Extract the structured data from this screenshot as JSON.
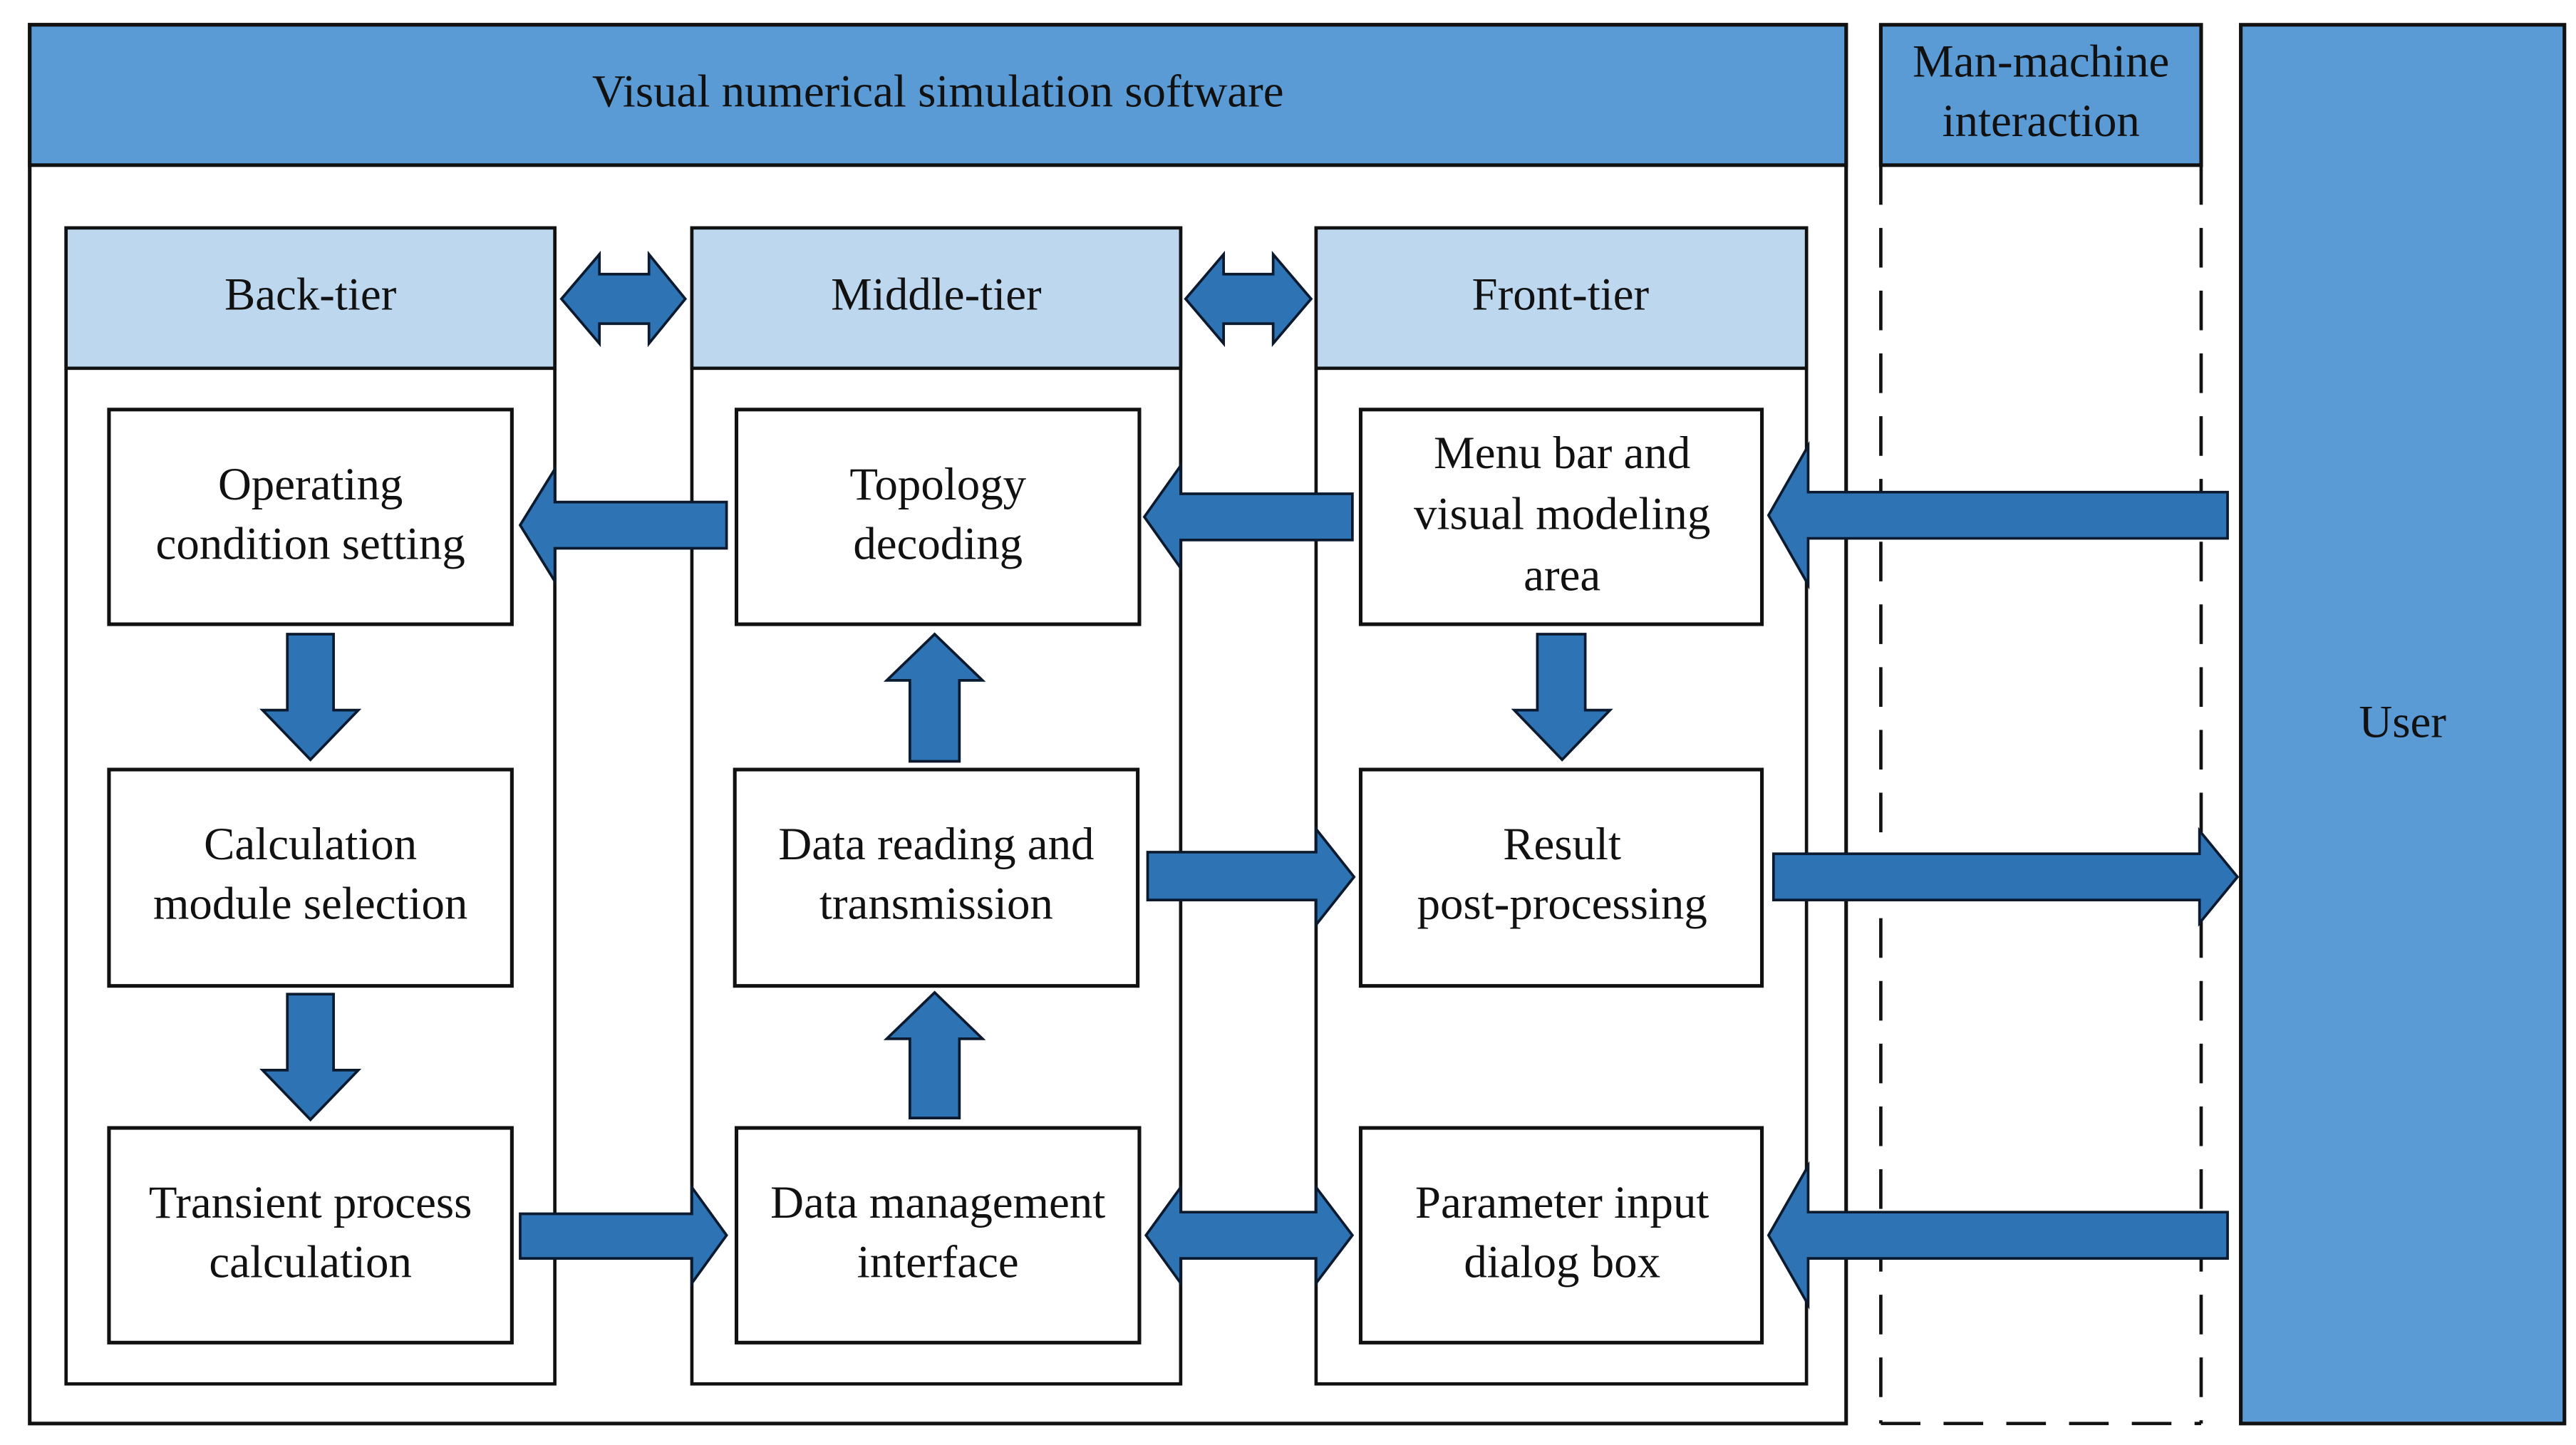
{
  "software": {
    "title": "Visual numerical simulation software"
  },
  "interaction": {
    "title_line1": "Man-machine",
    "title_line2": "interaction"
  },
  "user": {
    "label": "User"
  },
  "tiers": [
    {
      "name": "Back-tier",
      "boxes": [
        {
          "line1": "Operating",
          "line2": "condition setting"
        },
        {
          "line1": "Calculation",
          "line2": "module selection"
        },
        {
          "line1": "Transient process",
          "line2": "calculation"
        }
      ]
    },
    {
      "name": "Middle-tier",
      "boxes": [
        {
          "line1": "Topology",
          "line2": "decoding"
        },
        {
          "line1": "Data reading and",
          "line2": "transmission"
        },
        {
          "line1": "Data management",
          "line2": "interface"
        }
      ]
    },
    {
      "name": "Front-tier",
      "boxes": [
        {
          "line1": "Menu bar and",
          "line2": "visual modeling",
          "line3": "area"
        },
        {
          "line1": "Result",
          "line2": "post-processing"
        },
        {
          "line1": "Parameter input",
          "line2": "dialog box"
        }
      ]
    }
  ],
  "connections": [
    {
      "from": "Back-tier",
      "to": "Middle-tier",
      "type": "bidirectional"
    },
    {
      "from": "Middle-tier",
      "to": "Front-tier",
      "type": "bidirectional"
    },
    {
      "from": "Topology decoding",
      "to": "Operating condition setting",
      "type": "directed"
    },
    {
      "from": "Menu bar and visual modeling area",
      "to": "Topology decoding",
      "type": "directed"
    },
    {
      "from": "User",
      "to": "Menu bar and visual modeling area",
      "type": "directed"
    },
    {
      "from": "Operating condition setting",
      "to": "Calculation module selection",
      "type": "directed"
    },
    {
      "from": "Calculation module selection",
      "to": "Transient process calculation",
      "type": "directed"
    },
    {
      "from": "Data reading and transmission",
      "to": "Topology decoding",
      "type": "directed"
    },
    {
      "from": "Data management interface",
      "to": "Data reading and transmission",
      "type": "directed"
    },
    {
      "from": "Menu bar and visual modeling area",
      "to": "Result post-processing",
      "type": "directed"
    },
    {
      "from": "Data reading and transmission",
      "to": "Result post-processing",
      "type": "directed"
    },
    {
      "from": "Result post-processing",
      "to": "User",
      "type": "directed"
    },
    {
      "from": "Transient process calculation",
      "to": "Data management interface",
      "type": "directed"
    },
    {
      "from": "Data management interface",
      "to": "Parameter input dialog box",
      "type": "bidirectional"
    },
    {
      "from": "User",
      "to": "Parameter input dialog box",
      "type": "directed"
    }
  ],
  "colors": {
    "title_band": "#5B9BD5",
    "tier_header": "#BDD7EE",
    "arrow": "#2E74B5",
    "user_block": "#5B9BD5"
  }
}
